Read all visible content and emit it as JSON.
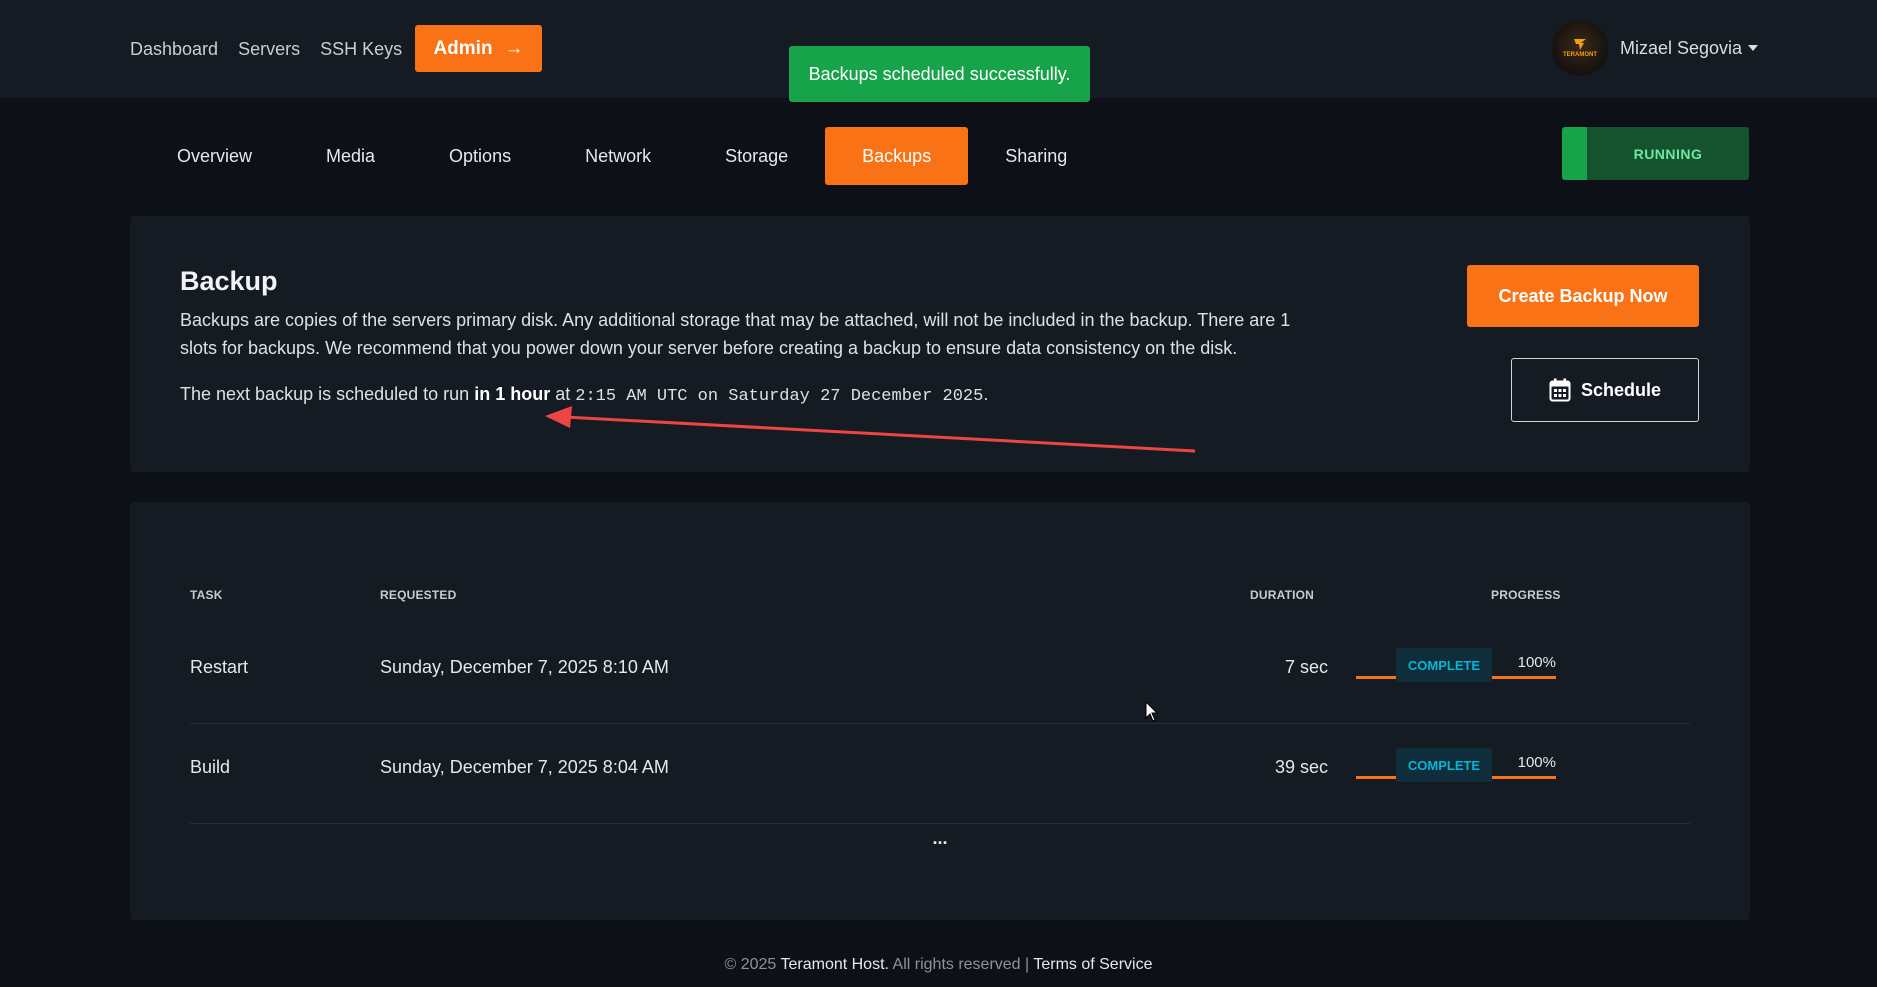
{
  "nav": {
    "links": [
      "Dashboard",
      "Servers",
      "SSH Keys"
    ],
    "admin_label": "Admin",
    "admin_arrow": "→"
  },
  "toast": {
    "message": "Backups scheduled successfully."
  },
  "user": {
    "name": "Mizael Segovia",
    "avatar_text": "TERAMONT"
  },
  "tabs": [
    "Overview",
    "Media",
    "Options",
    "Network",
    "Storage",
    "Backups",
    "Sharing"
  ],
  "active_tab": "Backups",
  "server_status": {
    "label": "RUNNING"
  },
  "backup": {
    "title": "Backup",
    "description": "Backups are copies of the servers primary disk. Any additional storage that may be attached, will not be included in the backup. There are 1 slots for backups. We recommend that you power down your server before creating a backup to ensure data consistency on the disk.",
    "next_prefix": "The next backup is scheduled to run",
    "next_relative": "in 1 hour",
    "next_at": "at",
    "next_time": "2:15 AM UTC on Saturday 27 December 2025",
    "next_suffix": ".",
    "create_label": "Create Backup Now",
    "schedule_label": "Schedule"
  },
  "table": {
    "headers": {
      "task": "TASK",
      "requested": "REQUESTED",
      "duration": "DURATION",
      "progress": "PROGRESS"
    },
    "rows": [
      {
        "task": "Restart",
        "requested": "Sunday, December 7, 2025 8:10 AM",
        "duration": "7 sec",
        "progress": "100%",
        "progress_value": 1.0,
        "status": "COMPLETE"
      },
      {
        "task": "Build",
        "requested": "Sunday, December 7, 2025 8:04 AM",
        "duration": "39 sec",
        "progress": "100%",
        "progress_value": 1.0,
        "status": "COMPLETE"
      }
    ],
    "more": "..."
  },
  "footer": {
    "copyright": "© 2025",
    "company": "Teramont Host.",
    "rights": "All rights reserved",
    "separator": "|",
    "terms": "Terms of Service"
  },
  "colors": {
    "accent": "#f97316",
    "success": "#16a34a",
    "status_complete": "#06b6d4",
    "background": "#0d1117",
    "card": "#151b23"
  }
}
